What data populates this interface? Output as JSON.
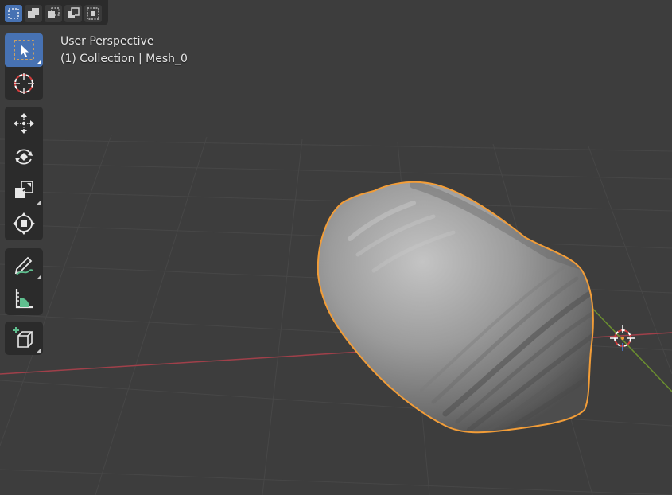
{
  "viewport": {
    "perspective_label": "User Perspective",
    "collection_label": "(1) Collection | Mesh_0"
  },
  "select_modes": [
    {
      "name": "select-new-icon",
      "active": true
    },
    {
      "name": "select-extend-icon",
      "active": false
    },
    {
      "name": "select-subtract-icon",
      "active": false
    },
    {
      "name": "select-invert-icon",
      "active": false
    },
    {
      "name": "select-intersect-icon",
      "active": false
    }
  ],
  "toolbar": {
    "tools": [
      {
        "name": "select-box-tool",
        "icon": "cursor-arrow-icon",
        "active": true
      },
      {
        "name": "cursor-tool",
        "icon": "3d-cursor-icon",
        "active": false
      },
      {
        "name": "move-tool",
        "icon": "move-arrows-icon",
        "active": false
      },
      {
        "name": "rotate-tool",
        "icon": "rotate-icon",
        "active": false
      },
      {
        "name": "scale-tool",
        "icon": "scale-icon",
        "active": false
      },
      {
        "name": "transform-tool",
        "icon": "transform-icon",
        "active": false
      },
      {
        "name": "annotate-tool",
        "icon": "pencil-annotate-icon",
        "active": false
      },
      {
        "name": "measure-tool",
        "icon": "ruler-measure-icon",
        "active": false
      },
      {
        "name": "add-cube-tool",
        "icon": "add-cube-icon",
        "active": false
      }
    ]
  },
  "colors": {
    "background": "#3d3d3d",
    "panel": "#2b2b2b",
    "active_blue": "#4772b3",
    "selection_outline": "#f29d38",
    "x_axis": "#a0404a",
    "y_axis": "#6b8f2f"
  }
}
